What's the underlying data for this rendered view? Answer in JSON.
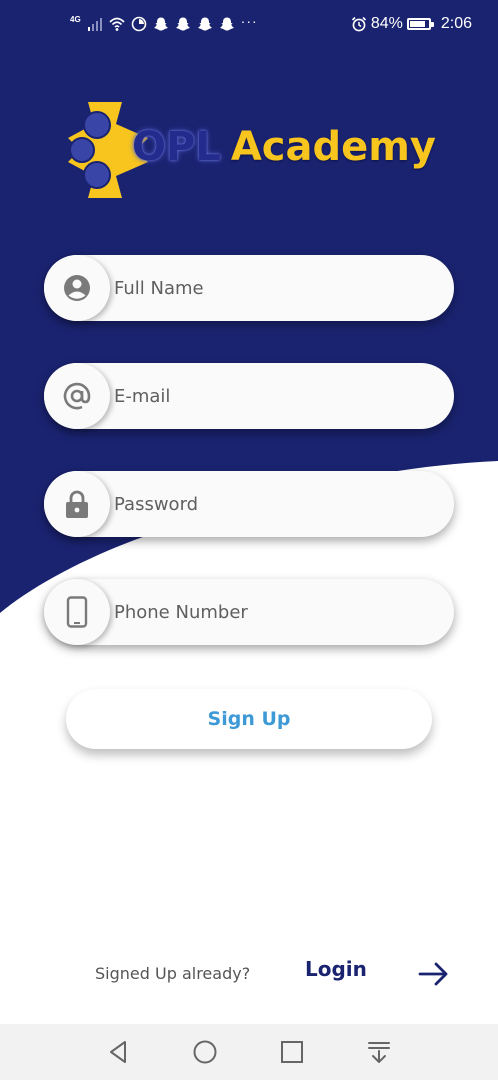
{
  "status_bar": {
    "network_label": "4G",
    "more": "···",
    "battery_level": 84,
    "battery_text": "84%",
    "time": "2:06",
    "icons": [
      "signal-icon",
      "wifi-icon",
      "data-saver-icon",
      "snapchat-icon",
      "snapchat-icon",
      "snapchat-icon",
      "snapchat-icon",
      "alarm-icon",
      "battery-icon"
    ]
  },
  "logo": {
    "prefix": "OPL",
    "name": "Academy"
  },
  "form": {
    "full_name_placeholder": "Full Name",
    "email_placeholder": "E-mail",
    "password_placeholder": "Password",
    "phone_placeholder": "Phone Number",
    "signup_label": "Sign Up"
  },
  "footer": {
    "signed_up_text": "Signed Up already?",
    "login_label": "Login"
  },
  "nav_bar": {
    "icons": [
      "back-icon",
      "home-icon",
      "recents-icon",
      "notification-pull-icon"
    ]
  },
  "colors": {
    "brand_blue": "#1a2370",
    "accent_yellow": "#f7c51e",
    "button_text": "#3e9ad6"
  }
}
